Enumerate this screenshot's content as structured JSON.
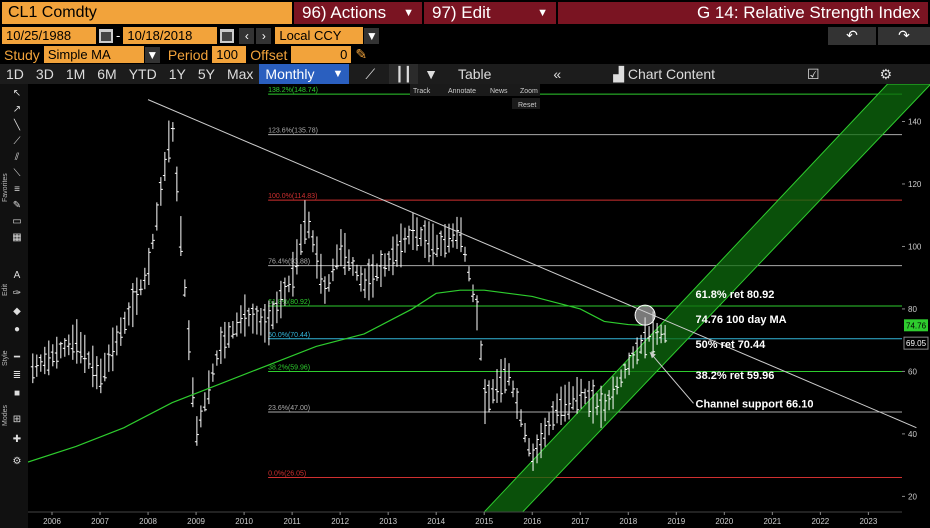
{
  "header": {
    "ticker": "CL1 Comdty",
    "actions_label": "96) Actions",
    "edit_label": "97) Edit",
    "title": "G 14: Relative Strength Index"
  },
  "dates": {
    "start": "10/25/1988",
    "separator": "-",
    "end": "10/18/2018",
    "currency": "Local CCY"
  },
  "study": {
    "label": "Study",
    "value": "Simple MA",
    "period_label": "Period",
    "period_value": "100",
    "offset_label": "Offset",
    "offset_value": "0"
  },
  "toolbar": {
    "ranges": [
      "1D",
      "3D",
      "1M",
      "6M",
      "YTD",
      "1Y",
      "5Y",
      "Max"
    ],
    "frequency": "Monthly",
    "table_label": "Table",
    "chart_content_label": "Chart Content"
  },
  "annotation_menu": {
    "items": [
      "Track",
      "Annotate",
      "News",
      "Zoom"
    ],
    "reset": "Reset"
  },
  "sidebar_labels": [
    "Favorites",
    "Edit",
    "Style",
    "Modes"
  ],
  "colors": {
    "price": "#ffffff",
    "ma": "#2ecc2e",
    "channel": "#1a9a1a",
    "trendline": "#cccccc",
    "orange": "#f2a33b",
    "red_btn": "#7a1422"
  },
  "chart_data": {
    "type": "line",
    "x_axis": {
      "labels": [
        "2006",
        "2007",
        "2008",
        "2009",
        "2010",
        "2011",
        "2012",
        "2013",
        "2014",
        "2015",
        "2016",
        "2017",
        "2018",
        "2019",
        "2020",
        "2021",
        "2022",
        "2023"
      ]
    },
    "y_axis": {
      "ticks": [
        20,
        40,
        60,
        80,
        100,
        120,
        140
      ],
      "range": [
        15,
        152
      ]
    },
    "fib_levels": [
      {
        "label": "138.2%(148.74)",
        "value": 148.74,
        "color": "#2ecc2e"
      },
      {
        "label": "123.6%(135.78)",
        "value": 135.78,
        "color": "#aaaaaa"
      },
      {
        "label": "100.0%(114.83)",
        "value": 114.83,
        "color": "#d03030"
      },
      {
        "label": "76.4%(93.88)",
        "value": 93.88,
        "color": "#aaaaaa"
      },
      {
        "label": "61.8%(80.92)",
        "value": 80.92,
        "color": "#2ecc2e"
      },
      {
        "label": "50.0%(70.44)",
        "value": 70.44,
        "color": "#33b5d9"
      },
      {
        "label": "38.2%(59.96)",
        "value": 59.96,
        "color": "#2ecc2e"
      },
      {
        "label": "23.6%(47.00)",
        "value": 47.0,
        "color": "#aaaaaa"
      },
      {
        "label": "0.0%(26.05)",
        "value": 26.05,
        "color": "#d03030"
      }
    ],
    "price_series": {
      "name": "CL1 Comdty",
      "x": [
        2005.5,
        2006.0,
        2006.5,
        2007.0,
        2007.5,
        2008.0,
        2008.5,
        2008.7,
        2009.0,
        2009.5,
        2010.0,
        2010.5,
        2011.0,
        2011.3,
        2011.7,
        2012.0,
        2012.5,
        2013.0,
        2013.5,
        2014.0,
        2014.5,
        2014.9,
        2015.0,
        2015.5,
        2016.0,
        2016.5,
        2017.0,
        2017.5,
        2018.0,
        2018.4,
        2018.8
      ],
      "y": [
        60,
        65,
        70,
        58,
        75,
        92,
        140,
        100,
        40,
        68,
        78,
        75,
        90,
        110,
        85,
        100,
        88,
        95,
        105,
        100,
        105,
        75,
        50,
        60,
        32,
        48,
        53,
        48,
        62,
        72,
        72
      ]
    },
    "ma_series": {
      "name": "100 day MA",
      "x": [
        2005.5,
        2006.5,
        2007.5,
        2008.5,
        2009.5,
        2010.5,
        2011.5,
        2012.5,
        2013.5,
        2014.0,
        2014.5,
        2015.0,
        2015.5,
        2016.0,
        2016.5,
        2017.0,
        2017.5,
        2018.0,
        2018.3
      ],
      "y": [
        31,
        36,
        42,
        50,
        56,
        62,
        68,
        72,
        80,
        85,
        86,
        86,
        85,
        84,
        82,
        80,
        76,
        75,
        74.76
      ]
    },
    "trendline": {
      "x": [
        2008.0,
        2024.0
      ],
      "y": [
        147,
        42
      ]
    },
    "channel": {
      "lower": {
        "x": [
          2015.0,
          2023.4
        ],
        "y": [
          15,
          152
        ]
      },
      "upper": {
        "x": [
          2015.8,
          2024.3
        ],
        "y": [
          15,
          152
        ]
      }
    },
    "value_tags": [
      {
        "label": "74.76",
        "value": 74.76,
        "color": "#2ecc2e"
      },
      {
        "label": "69.05",
        "value": 69.05,
        "color": "#000000"
      }
    ],
    "annotations": [
      {
        "text": "61.8% ret 80.92"
      },
      {
        "text": "74.76 100 day MA"
      },
      {
        "text": "50% ret 70.44"
      },
      {
        "text": "38.2% ret 59.96"
      },
      {
        "text": "Channel support 66.10"
      }
    ]
  }
}
